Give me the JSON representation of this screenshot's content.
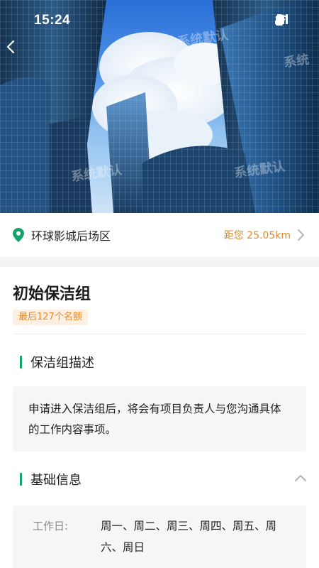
{
  "status_bar": {
    "time": "15:24"
  },
  "hero": {
    "watermark_text": "系统默认",
    "watermark_text_short": "系统"
  },
  "location": {
    "name": "环球影城后场区",
    "distance": "距您 25.05km"
  },
  "group": {
    "title": "初始保洁组",
    "quota": "最后127个名额"
  },
  "sections": {
    "description": {
      "title": "保洁组描述",
      "body": "申请进入保洁组后，将会有项目负责人与您沟通具体的工作内容事项。"
    },
    "basic_info": {
      "title": "基础信息",
      "workday_label": "工作日:",
      "workday_value": "周一、周二、周三、周四、周五、周六、周日"
    }
  },
  "colors": {
    "accent_green": "#16a36a",
    "accent_orange": "#e38a2a",
    "panel_bg": "#f6f6f8"
  },
  "icons": [
    "back-arrow-icon",
    "signal-icon",
    "wifi-icon",
    "battery-icon",
    "location-pin-icon",
    "chevron-right-icon",
    "chevron-up-icon"
  ]
}
